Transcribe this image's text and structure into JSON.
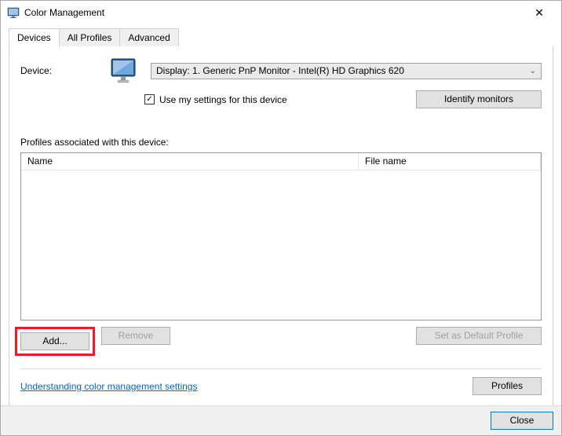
{
  "window": {
    "title": "Color Management"
  },
  "tabs": {
    "devices": "Devices",
    "all_profiles": "All Profiles",
    "advanced": "Advanced"
  },
  "device": {
    "label": "Device:",
    "selected": "Display: 1. Generic PnP Monitor - Intel(R) HD Graphics 620",
    "use_my_settings": "Use my settings for this device",
    "identify": "Identify monitors"
  },
  "profiles": {
    "section_label": "Profiles associated with this device:",
    "col_name": "Name",
    "col_file": "File name"
  },
  "buttons": {
    "add": "Add...",
    "remove": "Remove",
    "set_default": "Set as Default Profile",
    "profiles": "Profiles",
    "close": "Close"
  },
  "link": {
    "understanding": "Understanding color management settings"
  }
}
